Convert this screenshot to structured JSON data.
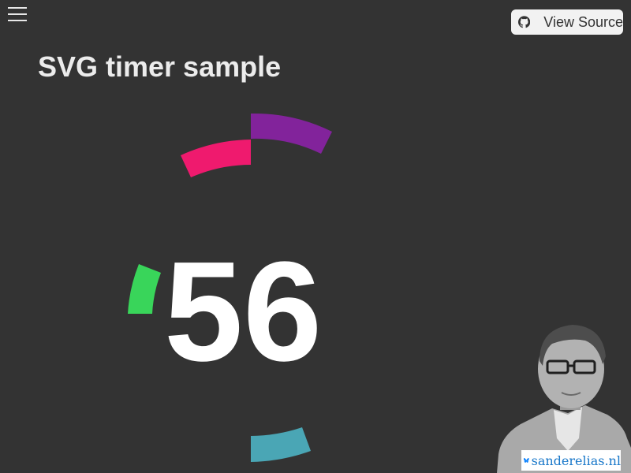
{
  "header": {
    "view_source_label": "View Source",
    "title": "SVG timer sample"
  },
  "timer": {
    "value": "56",
    "colors": {
      "purple": "#82239b",
      "pink": "#ef1a6e",
      "green": "#39d55a",
      "teal": "#4aa6b5"
    }
  },
  "footer": {
    "brand": "sanderelias.nl"
  },
  "icons": {
    "menu": "hamburger-menu-icon",
    "source": "github-icon",
    "brand": "butterfly-icon"
  },
  "colors": {
    "background": "#333333",
    "text": "#ececec",
    "button_bg": "#f2f2f2",
    "brand": "#1877c9"
  }
}
